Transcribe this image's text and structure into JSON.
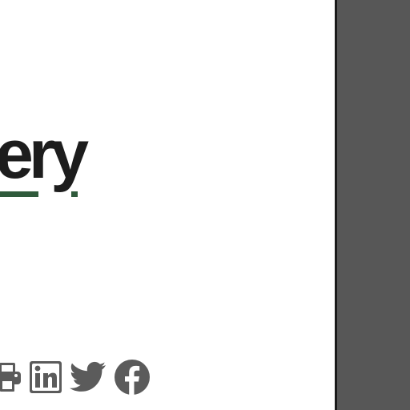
{
  "brand": {
    "wordmark_text": "ery"
  },
  "share": {
    "icons": [
      "print-icon",
      "linkedin-icon",
      "twitter-icon",
      "facebook-icon"
    ]
  },
  "colors": {
    "wordmark": "#1d1d1d",
    "accent_green": "#2f5a3b",
    "icon_gray": "#5b5b5b",
    "side_panel": "#575757"
  }
}
